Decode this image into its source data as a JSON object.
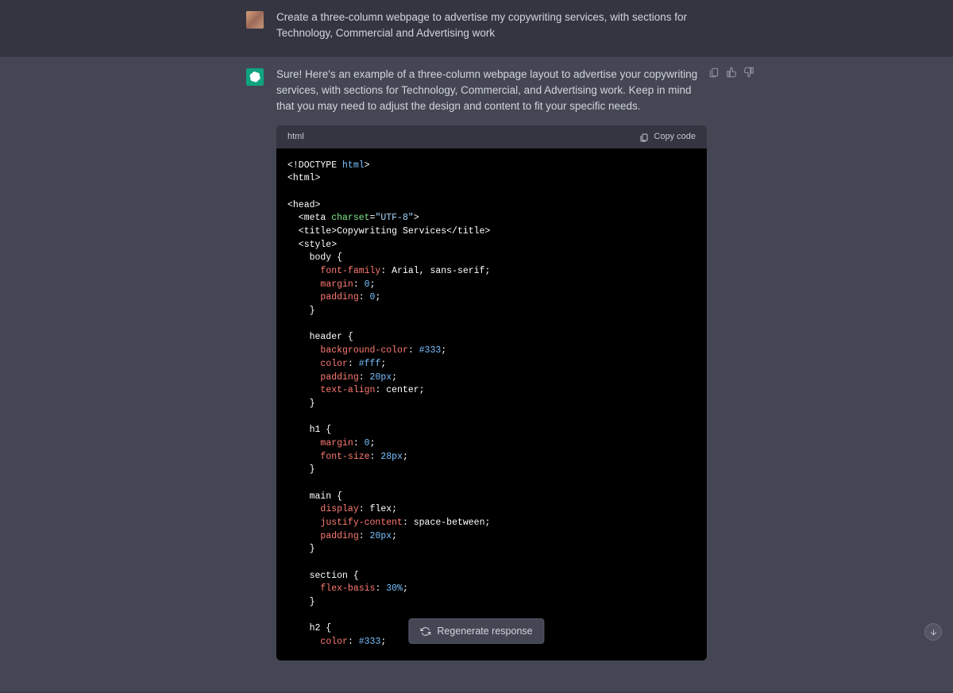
{
  "user_message": "Create a three-column webpage to advertise my copywriting services, with sections for Technology, Commercial and Advertising work",
  "assistant_message": "Sure! Here's an example of a three-column webpage layout to advertise your copywriting services, with sections for Technology, Commercial, and Advertising work. Keep in mind that you may need to adjust the design and content to fit your specific needs.",
  "code_block": {
    "language": "html",
    "copy_label": "Copy code",
    "tokens": [
      {
        "t": "<!DOCTYPE ",
        "c": "tok-tag"
      },
      {
        "t": "html",
        "c": "tok-kw"
      },
      {
        "t": ">",
        "c": "tok-tag"
      },
      {
        "t": "\n"
      },
      {
        "t": "<html>",
        "c": "tok-tag"
      },
      {
        "t": "\n"
      },
      {
        "t": "\n"
      },
      {
        "t": "<head>",
        "c": "tok-tag"
      },
      {
        "t": "\n"
      },
      {
        "t": "  <meta ",
        "c": "tok-tag"
      },
      {
        "t": "charset",
        "c": "tok-attr"
      },
      {
        "t": "=",
        "c": "tok-tag"
      },
      {
        "t": "\"UTF-8\"",
        "c": "tok-str"
      },
      {
        "t": ">",
        "c": "tok-tag"
      },
      {
        "t": "\n"
      },
      {
        "t": "  <title>",
        "c": "tok-tag"
      },
      {
        "t": "Copywriting Services",
        "c": "tok-val"
      },
      {
        "t": "</title>",
        "c": "tok-tag"
      },
      {
        "t": "\n"
      },
      {
        "t": "  <style>",
        "c": "tok-tag"
      },
      {
        "t": "\n"
      },
      {
        "t": "    body {",
        "c": "tok-val"
      },
      {
        "t": "\n"
      },
      {
        "t": "      ",
        "c": ""
      },
      {
        "t": "font-family",
        "c": "tok-css-kw"
      },
      {
        "t": ": Arial, sans-serif;",
        "c": "tok-val"
      },
      {
        "t": "\n"
      },
      {
        "t": "      ",
        "c": ""
      },
      {
        "t": "margin",
        "c": "tok-css-kw"
      },
      {
        "t": ": ",
        "c": "tok-val"
      },
      {
        "t": "0",
        "c": "tok-num"
      },
      {
        "t": ";",
        "c": "tok-val"
      },
      {
        "t": "\n"
      },
      {
        "t": "      ",
        "c": ""
      },
      {
        "t": "padding",
        "c": "tok-css-kw"
      },
      {
        "t": ": ",
        "c": "tok-val"
      },
      {
        "t": "0",
        "c": "tok-num"
      },
      {
        "t": ";",
        "c": "tok-val"
      },
      {
        "t": "\n"
      },
      {
        "t": "    }",
        "c": "tok-val"
      },
      {
        "t": "\n"
      },
      {
        "t": "\n"
      },
      {
        "t": "    header {",
        "c": "tok-val"
      },
      {
        "t": "\n"
      },
      {
        "t": "      ",
        "c": ""
      },
      {
        "t": "background-color",
        "c": "tok-css-kw"
      },
      {
        "t": ": ",
        "c": "tok-val"
      },
      {
        "t": "#333",
        "c": "tok-num"
      },
      {
        "t": ";",
        "c": "tok-val"
      },
      {
        "t": "\n"
      },
      {
        "t": "      ",
        "c": ""
      },
      {
        "t": "color",
        "c": "tok-css-kw"
      },
      {
        "t": ": ",
        "c": "tok-val"
      },
      {
        "t": "#fff",
        "c": "tok-num"
      },
      {
        "t": ";",
        "c": "tok-val"
      },
      {
        "t": "\n"
      },
      {
        "t": "      ",
        "c": ""
      },
      {
        "t": "padding",
        "c": "tok-css-kw"
      },
      {
        "t": ": ",
        "c": "tok-val"
      },
      {
        "t": "20px",
        "c": "tok-num"
      },
      {
        "t": ";",
        "c": "tok-val"
      },
      {
        "t": "\n"
      },
      {
        "t": "      ",
        "c": ""
      },
      {
        "t": "text-align",
        "c": "tok-css-kw"
      },
      {
        "t": ": center;",
        "c": "tok-val"
      },
      {
        "t": "\n"
      },
      {
        "t": "    }",
        "c": "tok-val"
      },
      {
        "t": "\n"
      },
      {
        "t": "\n"
      },
      {
        "t": "    h1 {",
        "c": "tok-val"
      },
      {
        "t": "\n"
      },
      {
        "t": "      ",
        "c": ""
      },
      {
        "t": "margin",
        "c": "tok-css-kw"
      },
      {
        "t": ": ",
        "c": "tok-val"
      },
      {
        "t": "0",
        "c": "tok-num"
      },
      {
        "t": ";",
        "c": "tok-val"
      },
      {
        "t": "\n"
      },
      {
        "t": "      ",
        "c": ""
      },
      {
        "t": "font-size",
        "c": "tok-css-kw"
      },
      {
        "t": ": ",
        "c": "tok-val"
      },
      {
        "t": "28px",
        "c": "tok-num"
      },
      {
        "t": ";",
        "c": "tok-val"
      },
      {
        "t": "\n"
      },
      {
        "t": "    }",
        "c": "tok-val"
      },
      {
        "t": "\n"
      },
      {
        "t": "\n"
      },
      {
        "t": "    main {",
        "c": "tok-val"
      },
      {
        "t": "\n"
      },
      {
        "t": "      ",
        "c": ""
      },
      {
        "t": "display",
        "c": "tok-css-kw"
      },
      {
        "t": ": flex;",
        "c": "tok-val"
      },
      {
        "t": "\n"
      },
      {
        "t": "      ",
        "c": ""
      },
      {
        "t": "justify-content",
        "c": "tok-css-kw"
      },
      {
        "t": ": space-between;",
        "c": "tok-val"
      },
      {
        "t": "\n"
      },
      {
        "t": "      ",
        "c": ""
      },
      {
        "t": "padding",
        "c": "tok-css-kw"
      },
      {
        "t": ": ",
        "c": "tok-val"
      },
      {
        "t": "20px",
        "c": "tok-num"
      },
      {
        "t": ";",
        "c": "tok-val"
      },
      {
        "t": "\n"
      },
      {
        "t": "    }",
        "c": "tok-val"
      },
      {
        "t": "\n"
      },
      {
        "t": "\n"
      },
      {
        "t": "    section {",
        "c": "tok-val"
      },
      {
        "t": "\n"
      },
      {
        "t": "      ",
        "c": ""
      },
      {
        "t": "flex-basis",
        "c": "tok-css-kw"
      },
      {
        "t": ": ",
        "c": "tok-val"
      },
      {
        "t": "30%",
        "c": "tok-num"
      },
      {
        "t": ";",
        "c": "tok-val"
      },
      {
        "t": "\n"
      },
      {
        "t": "    }",
        "c": "tok-val"
      },
      {
        "t": "\n"
      },
      {
        "t": "\n"
      },
      {
        "t": "    h2 {",
        "c": "tok-val"
      },
      {
        "t": "\n"
      },
      {
        "t": "      ",
        "c": ""
      },
      {
        "t": "color",
        "c": "tok-css-kw"
      },
      {
        "t": ": ",
        "c": "tok-val"
      },
      {
        "t": "#333",
        "c": "tok-num"
      },
      {
        "t": ";",
        "c": "tok-val"
      }
    ]
  },
  "regenerate_label": "Regenerate response"
}
